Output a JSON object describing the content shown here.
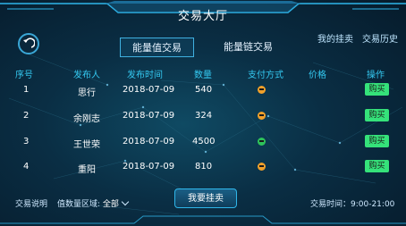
{
  "header": {
    "title": "交易大厅"
  },
  "tabs": [
    {
      "label": "能量值交易",
      "active": true
    },
    {
      "label": "能量链交易",
      "active": false
    }
  ],
  "links": {
    "my_sell": "我的挂卖",
    "history": "交易历史"
  },
  "table": {
    "headers": [
      "序号",
      "发布人",
      "发布时间",
      "数量",
      "支付方式",
      "价格",
      "操作"
    ],
    "rows": [
      {
        "no": "1",
        "publisher": "思行",
        "time": "2018-07-09",
        "qty": "540",
        "pay": "orange",
        "price": "",
        "action": "购买"
      },
      {
        "no": "2",
        "publisher": "余刚志",
        "time": "2018-07-09",
        "qty": "324",
        "pay": "orange",
        "price": "",
        "action": "购买"
      },
      {
        "no": "3",
        "publisher": "王世荣",
        "time": "2018-07-09",
        "qty": "4500",
        "pay": "green",
        "price": "",
        "action": "购买"
      },
      {
        "no": "4",
        "publisher": "重阳",
        "time": "2018-07-09",
        "qty": "810",
        "pay": "orange",
        "price": "",
        "action": "购买"
      }
    ]
  },
  "bottom": {
    "instructions": "交易说明",
    "range_label": "值数量区域:",
    "range_value": "全部",
    "sell_button": "我要挂卖",
    "trade_time": "交易时间：9:00-21:00"
  },
  "colors": {
    "accent": "#34c8f0",
    "buy": "#35e27a",
    "pay_orange": "#f0a02a",
    "pay_green": "#2ec25a"
  },
  "icons": {
    "back": "back-arrow-icon",
    "dropdown": "chevron-down-icon"
  }
}
